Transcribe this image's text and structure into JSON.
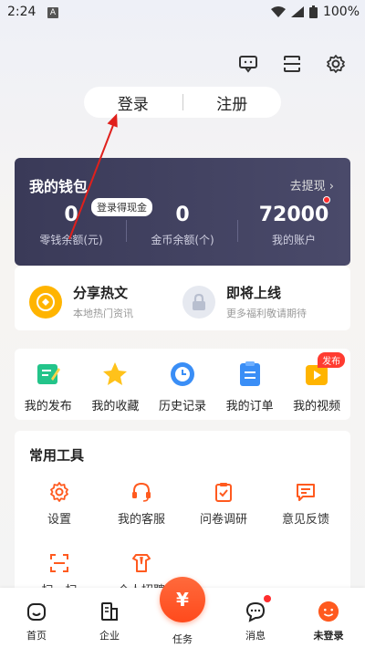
{
  "status": {
    "time": "2:24",
    "notif": "A",
    "battery": "100%"
  },
  "auth": {
    "login": "登录",
    "register": "注册"
  },
  "wallet": {
    "title": "我的钱包",
    "withdraw": "去提现 ›",
    "badge": "登录得现金",
    "change": {
      "value": "0",
      "label": "零钱余额(元)"
    },
    "coins": {
      "value": "0",
      "label": "金币余额(个)"
    },
    "account": {
      "value": "72000",
      "label": "我的账户"
    }
  },
  "promo": [
    {
      "title": "分享热文",
      "sub": "本地热门资讯",
      "icon": "coin-icon"
    },
    {
      "title": "即将上线",
      "sub": "更多福利敬请期待",
      "icon": "lock-icon"
    }
  ],
  "quick": [
    {
      "label": "我的发布",
      "icon": "edit-icon"
    },
    {
      "label": "我的收藏",
      "icon": "star-icon"
    },
    {
      "label": "历史记录",
      "icon": "clock-icon"
    },
    {
      "label": "我的订单",
      "icon": "order-icon"
    },
    {
      "label": "我的视频",
      "icon": "video-icon",
      "badge": "发布"
    }
  ],
  "tools": {
    "title": "常用工具",
    "items": [
      {
        "label": "设置",
        "icon": "gear-icon"
      },
      {
        "label": "我的客服",
        "icon": "headset-icon"
      },
      {
        "label": "问卷调研",
        "icon": "survey-icon"
      },
      {
        "label": "意见反馈",
        "icon": "feedback-icon"
      },
      {
        "label": "扫一扫",
        "icon": "scan-icon"
      },
      {
        "label": "个人招聘",
        "icon": "recruit-icon"
      }
    ]
  },
  "tabs": [
    {
      "label": "首页",
      "icon": "home-icon"
    },
    {
      "label": "企业",
      "icon": "building-icon"
    },
    {
      "label": "任务",
      "icon": "yen-icon"
    },
    {
      "label": "消息",
      "icon": "message-icon"
    },
    {
      "label": "未登录",
      "icon": "avatar-icon"
    }
  ],
  "colors": {
    "accent": "#ff5a1f",
    "wallet_bg": "#3f3f5e",
    "blue": "#3a8ef6",
    "yellow": "#ffb400"
  }
}
